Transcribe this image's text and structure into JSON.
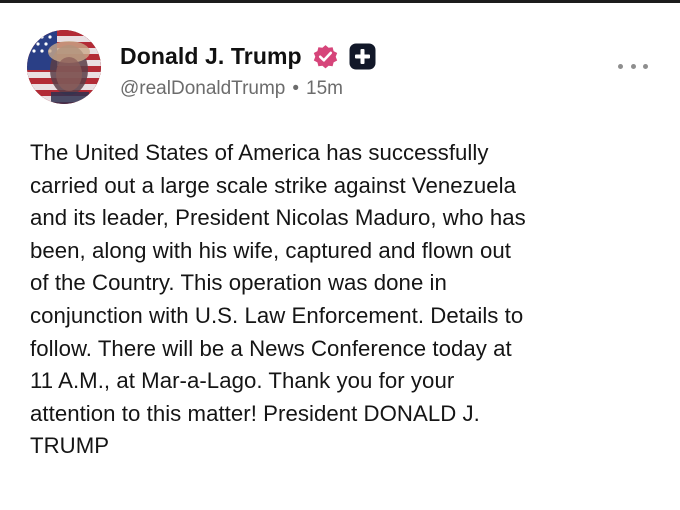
{
  "post": {
    "author": {
      "display_name": "Donald J. Trump",
      "handle": "@realDonaldTrump",
      "separator": "•",
      "time_ago": "15m",
      "verified_icon": "verified-badge-icon",
      "extra_icon": "plus-badge-icon",
      "avatar": "profile-avatar"
    },
    "more_icon": "more-options-icon",
    "lines": [
      "The United States of America has successfully",
      "carried out a large scale strike against Venezuela",
      "and its leader, President Nicolas Maduro, who has",
      "been, along with his wife, captured and flown out",
      "of the Country. This operation was done in",
      "conjunction with U.S. Law Enforcement. Details to",
      "follow. There will be a News Conference today at",
      "11 A.M., at Mar-a-Lago. Thank you for your",
      "attention to this matter! President DONALD J.",
      "TRUMP"
    ]
  },
  "colors": {
    "verified": "#d6457a",
    "plus_badge": "#121829",
    "handle": "#6c6c6c",
    "text": "#151515"
  }
}
